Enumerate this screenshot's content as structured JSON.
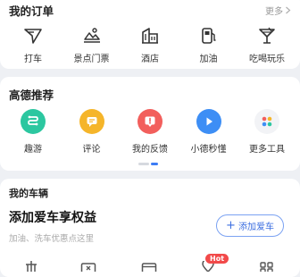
{
  "orders": {
    "title": "我的订单",
    "more_label": "更多",
    "items": [
      {
        "label": "打车",
        "icon": "taxi-icon"
      },
      {
        "label": "景点门票",
        "icon": "scenic-ticket-icon"
      },
      {
        "label": "酒店",
        "icon": "hotel-icon"
      },
      {
        "label": "加油",
        "icon": "fuel-pump-icon"
      },
      {
        "label": "吃喝玩乐",
        "icon": "cocktail-icon"
      }
    ]
  },
  "recommend": {
    "title": "高德推荐",
    "items": [
      {
        "label": "趣游",
        "icon": "fun-travel-icon",
        "color": "#2cc7a0"
      },
      {
        "label": "评论",
        "icon": "comment-icon",
        "color": "#f5b52a"
      },
      {
        "label": "我的反馈",
        "icon": "feedback-icon",
        "color": "#f25f5c"
      },
      {
        "label": "小德秒懂",
        "icon": "play-icon",
        "color": "#3d8ef5"
      },
      {
        "label": "更多工具",
        "icon": "more-tools-icon",
        "color": "#f2f3f6"
      }
    ]
  },
  "vehicles": {
    "title": "我的车辆",
    "headline": "添加爱车享权益",
    "subtitle": "加油、洗车优惠点这里",
    "add_button_label": "添加爱车",
    "hot_badge": "Hot"
  },
  "colors": {
    "accent": "#3d7cf5",
    "background": "#eef0f4"
  }
}
